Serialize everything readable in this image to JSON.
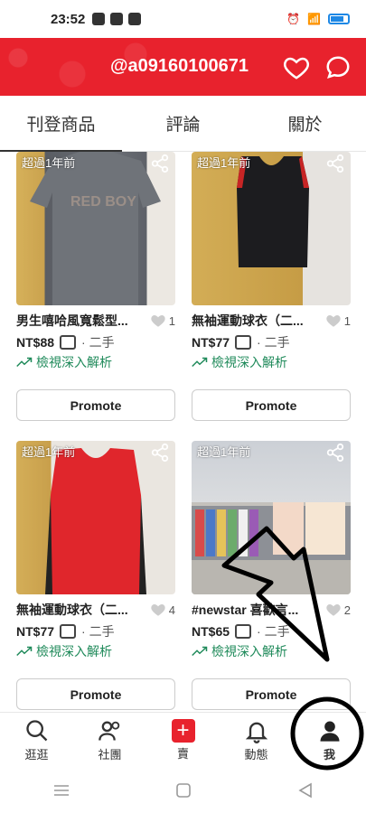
{
  "status_bar": {
    "time": "23:52"
  },
  "header": {
    "username": "@a09160100671"
  },
  "tabs": [
    {
      "label": "刊登商品",
      "active": true
    },
    {
      "label": "評論",
      "active": false
    },
    {
      "label": "關於",
      "active": false
    }
  ],
  "listings": [
    {
      "age": "超過1年前",
      "title": "男生嘻哈風寬鬆型...",
      "likes": "1",
      "price": "NT$88",
      "condition": "· 二手",
      "insight": "檢視深入解析",
      "promote": "Promote"
    },
    {
      "age": "超過1年前",
      "title": "無袖運動球衣（二...",
      "likes": "1",
      "price": "NT$77",
      "condition": "· 二手",
      "insight": "檢視深入解析",
      "promote": "Promote"
    },
    {
      "age": "超過1年前",
      "title": "無袖運動球衣（二...",
      "likes": "4",
      "price": "NT$77",
      "condition": "· 二手",
      "insight": "檢視深入解析",
      "promote": "Promote"
    },
    {
      "age": "超過1年前",
      "title": "#newstar 喜歡言...",
      "likes": "2",
      "price": "NT$65",
      "condition": "· 二手",
      "insight": "檢視深入解析",
      "promote": "Promote"
    }
  ],
  "bottom_nav": [
    {
      "label": "逛逛",
      "icon": "search-icon"
    },
    {
      "label": "社團",
      "icon": "people-icon"
    },
    {
      "label": "賣",
      "icon": "plus-icon"
    },
    {
      "label": "動態",
      "icon": "bell-icon"
    },
    {
      "label": "我",
      "icon": "profile-icon"
    }
  ],
  "colors": {
    "brand_red": "#e8222d",
    "insight_green": "#1f8a5a"
  }
}
